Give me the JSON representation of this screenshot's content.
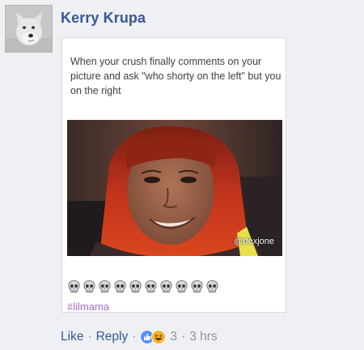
{
  "comment": {
    "author": "Kerry Krupa",
    "post": {
      "caption": "When your crush finally comments on your picture and ask \"who shorty on the left\" but you on the right",
      "watermark": "@dexjone",
      "emoji_icon": "skull-emoji-icon",
      "emoji_count": 10,
      "hashtag": "#lilmama"
    },
    "actions": {
      "like_label": "Like",
      "reply_label": "Reply",
      "reaction_icons": [
        "like-reaction-icon",
        "haha-reaction-icon"
      ],
      "reaction_count": "3",
      "timestamp": "3 hrs"
    }
  },
  "colors": {
    "author_link": "#365899",
    "meta_text": "#90949c",
    "hashtag": "#a66acc",
    "like_blue": "#5890ff",
    "haha_yellow": "#f7b125"
  }
}
